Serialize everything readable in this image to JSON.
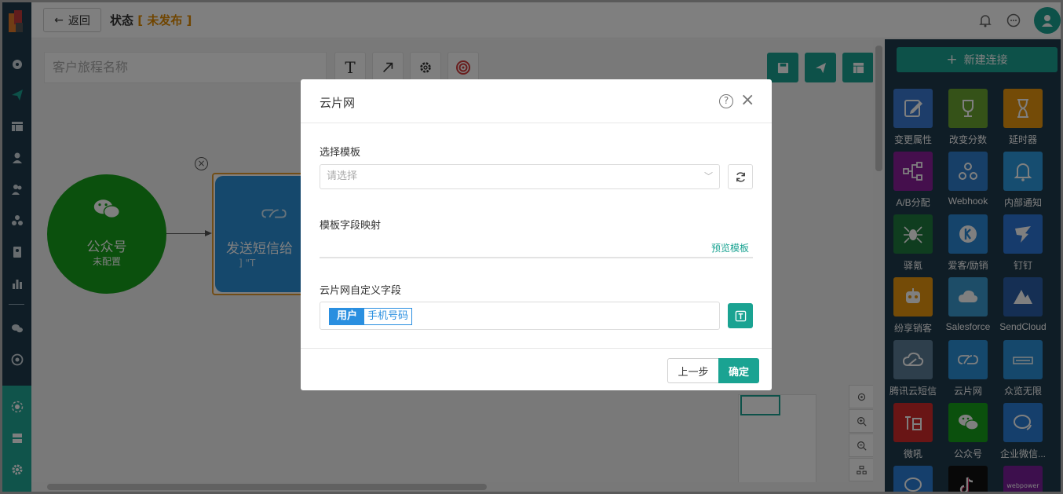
{
  "topbar": {
    "back_label": "返回",
    "status_label": "状态",
    "status_value": "[ 未发布 ]"
  },
  "canvas": {
    "journey_name_placeholder": "客户旅程名称",
    "node_wechat": {
      "title": "公众号",
      "subtitle": "未配置"
    },
    "node_sms": {
      "title": "发送短信给",
      "subtitle": "] \"T"
    }
  },
  "right_panel": {
    "new_connection_label": "新建连接",
    "tiles": [
      {
        "label": "变更属性",
        "color": "#3a7bd5",
        "icon": "edit-icon"
      },
      {
        "label": "改变分数",
        "color": "#6aa531",
        "icon": "trophy-icon"
      },
      {
        "label": "延时器",
        "color": "#e8960f",
        "icon": "hourglass-icon"
      },
      {
        "label": "A/B分配",
        "color": "#8a1e9b",
        "icon": "ab-split-icon"
      },
      {
        "label": "Webhook",
        "color": "#2e7fcf",
        "icon": "webhook-icon"
      },
      {
        "label": "内部通知",
        "color": "#2d9be0",
        "icon": "bell-icon"
      },
      {
        "label": "驿氪",
        "color": "#1f7a3e",
        "icon": "spider-icon"
      },
      {
        "label": "爱客/励销",
        "color": "#2a88d6",
        "icon": "k-logo-icon"
      },
      {
        "label": "钉钉",
        "color": "#2c76d8",
        "icon": "dingtalk-icon"
      },
      {
        "label": "纷享销客",
        "color": "#e8960f",
        "icon": "robot-icon"
      },
      {
        "label": "Salesforce",
        "color": "#3a9ad0",
        "icon": "cloud-icon"
      },
      {
        "label": "SendCloud",
        "color": "#2a5fa8",
        "icon": "sendcloud-icon"
      },
      {
        "label": "腾讯云短信",
        "color": "#5d7f98",
        "icon": "tencent-cloud-icon"
      },
      {
        "label": "云片网",
        "color": "#2a90d8",
        "icon": "yunpian-icon"
      },
      {
        "label": "众览无限",
        "color": "#2a90d8",
        "icon": "zhonglan-icon"
      },
      {
        "label": "微吼",
        "color": "#d32a2a",
        "icon": "weihou-icon"
      },
      {
        "label": "公众号",
        "color": "#17a11b",
        "icon": "wechat-icon"
      },
      {
        "label": "企业微信...",
        "color": "#2a7fd8",
        "icon": "wecom-icon"
      },
      {
        "label": "",
        "color": "#2a7fd8",
        "icon": "chat-icon"
      },
      {
        "label": "",
        "color": "#111111",
        "icon": "tiktok-icon"
      },
      {
        "label": "",
        "color": "#7a1e9b",
        "icon": "webpower-icon",
        "text": "webpower"
      }
    ]
  },
  "modal": {
    "title": "云片网",
    "template_label": "选择模板",
    "template_placeholder": "请选择",
    "mapping_label": "模板字段映射",
    "preview_label": "预览模板",
    "custom_label": "云片网自定义字段",
    "tag_key": "用户",
    "tag_value": "手机号码",
    "prev_label": "上一步",
    "ok_label": "确定"
  },
  "colors": {
    "accent": "#1aa392",
    "status": "#e08a00",
    "sidebar": "#1f3a4d"
  }
}
